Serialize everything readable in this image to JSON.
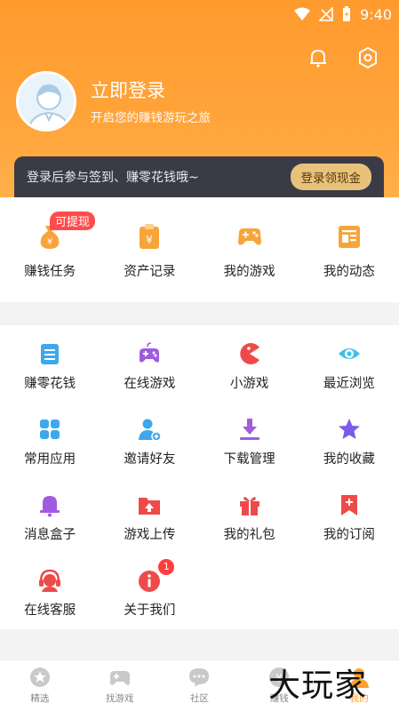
{
  "status": {
    "time": "9:40"
  },
  "header": {
    "login_title": "立即登录",
    "login_subtitle": "开启您的赚钱游玩之旅",
    "banner_text": "登录后参与签到、赚零花钱哦~",
    "banner_button": "登录领现金",
    "bg_color": "#ffa43a"
  },
  "quick": [
    {
      "label": "赚钱任务",
      "icon": "money-bag-icon",
      "badge": "可提现"
    },
    {
      "label": "资产记录",
      "icon": "clipboard-icon"
    },
    {
      "label": "我的游戏",
      "icon": "gamepad-icon"
    },
    {
      "label": "我的动态",
      "icon": "news-icon"
    }
  ],
  "menu": [
    {
      "label": "赚零花钱",
      "icon": "list-icon"
    },
    {
      "label": "在线游戏",
      "icon": "controller-icon"
    },
    {
      "label": "小游戏",
      "icon": "pacman-icon"
    },
    {
      "label": "最近浏览",
      "icon": "eye-icon"
    },
    {
      "label": "常用应用",
      "icon": "apps-icon"
    },
    {
      "label": "邀请好友",
      "icon": "add-user-icon"
    },
    {
      "label": "下载管理",
      "icon": "download-icon"
    },
    {
      "label": "我的收藏",
      "icon": "star-icon"
    },
    {
      "label": "消息盒子",
      "icon": "bell-icon"
    },
    {
      "label": "游戏上传",
      "icon": "upload-folder-icon"
    },
    {
      "label": "我的礼包",
      "icon": "gift-icon"
    },
    {
      "label": "我的订阅",
      "icon": "bookmark-icon"
    },
    {
      "label": "在线客服",
      "icon": "headset-icon"
    },
    {
      "label": "关于我们",
      "icon": "info-icon",
      "badge": "1"
    }
  ],
  "tabs": [
    {
      "label": "精选",
      "icon": "star-badge-icon"
    },
    {
      "label": "找游戏",
      "icon": "gamepad-icon"
    },
    {
      "label": "社区",
      "icon": "chat-icon"
    },
    {
      "label": "赚钱",
      "icon": "coin-icon"
    },
    {
      "label": "我的",
      "icon": "user-icon",
      "active": true
    }
  ],
  "watermark": "大玩家"
}
